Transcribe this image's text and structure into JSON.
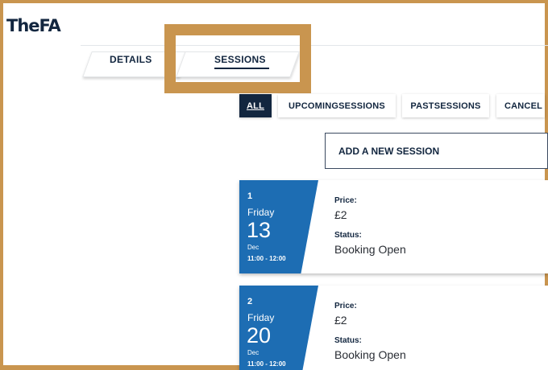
{
  "app": {
    "logo": "TheFA"
  },
  "tabs": [
    {
      "label": "DETAILS"
    },
    {
      "label": "SESSIONS"
    }
  ],
  "filters": [
    {
      "label": "ALL"
    },
    {
      "label": "UPCOMINGSESSIONS"
    },
    {
      "label": "PASTSESSIONS"
    },
    {
      "label": "CANCEL"
    }
  ],
  "add_session_label": "ADD A NEW SESSION",
  "sessions": [
    {
      "number": "1",
      "weekday": "Friday",
      "day": "13",
      "month": "Dec",
      "time": "11:00 - 12:00",
      "price_label": "Price:",
      "price": "£2",
      "status_label": "Status:",
      "status": "Booking Open"
    },
    {
      "number": "2",
      "weekday": "Friday",
      "day": "20",
      "month": "Dec",
      "time": "11:00 - 12:00",
      "price_label": "Price:",
      "price": "£2",
      "status_label": "Status:",
      "status": "Booking Open"
    }
  ],
  "colors": {
    "navy": "#12263f",
    "date_blue": "#1d6db3",
    "highlight": "#c9954f"
  }
}
